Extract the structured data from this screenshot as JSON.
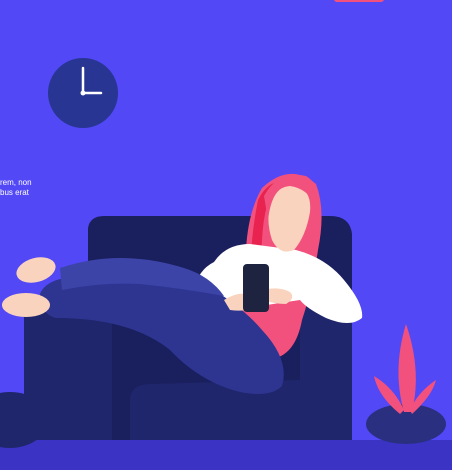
{
  "colors": {
    "background": "#5248f5",
    "clock_face": "#283593",
    "clock_hands": "#ffffff",
    "armchair_dark": "#1a1f5e",
    "armchair_mid": "#20266b",
    "jeans": "#2e3591",
    "jeans_highlight": "#3c44a8",
    "skin": "#f9d3bd",
    "hair": "#f2517d",
    "hair_dark": "#e8234f",
    "shirt": "#ffffff",
    "phone": "#1e2440",
    "plant_pot": "#2a2f80",
    "plant_leaf": "#f2517d",
    "floor": "#3a33c4",
    "badge": "#f2517d"
  },
  "icons": {
    "clock": "wall-clock-icon",
    "phone": "smartphone-icon",
    "plant": "potted-plant-icon"
  },
  "text_fragment": {
    "line1": "rem, non",
    "line2": "bus erat"
  }
}
